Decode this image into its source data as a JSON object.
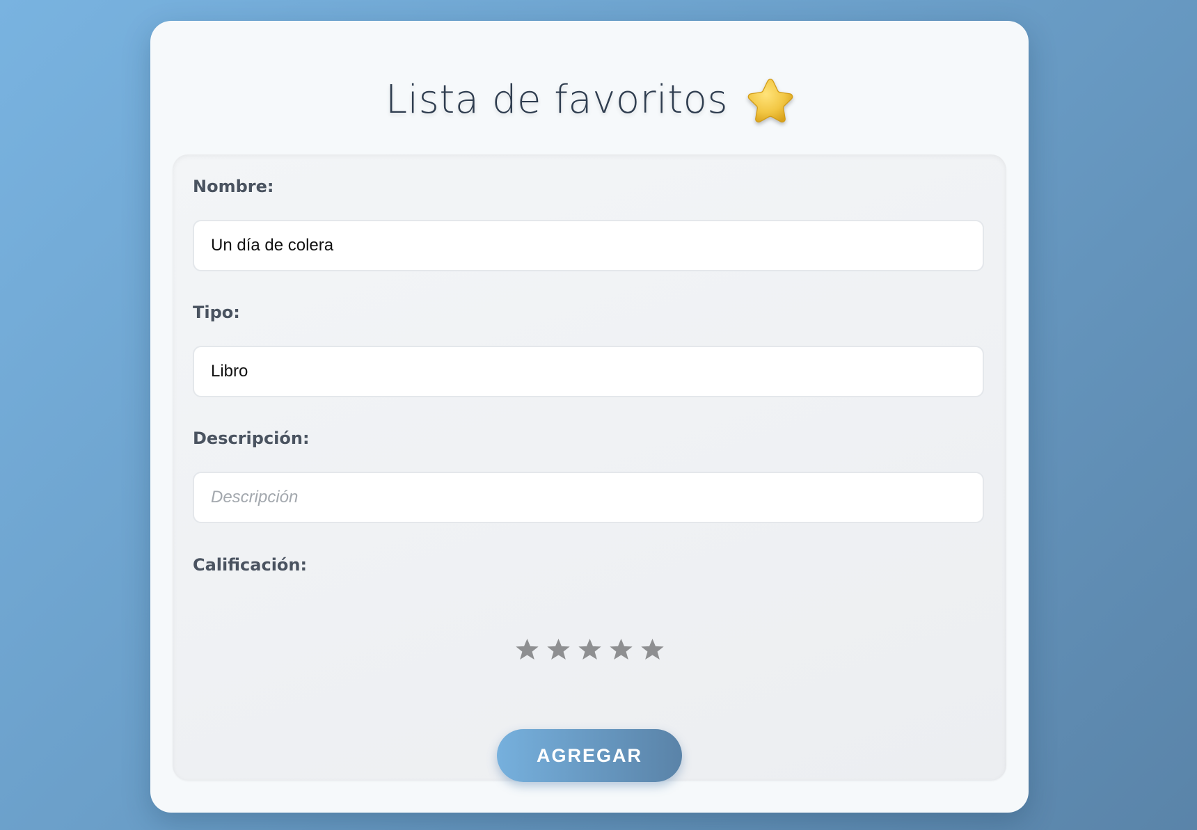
{
  "page": {
    "title": "Lista de favoritos",
    "title_icon": "star-icon"
  },
  "form": {
    "name": {
      "label": "Nombre:",
      "value": "Un día de colera"
    },
    "type": {
      "label": "Tipo:",
      "value": "Libro"
    },
    "description": {
      "label": "Descripción:",
      "value": "",
      "placeholder": "Descripción"
    },
    "rating": {
      "label": "Calificación:",
      "max": 5,
      "selected": 0,
      "star_color": "#8e8f91"
    },
    "submit_label": "AGREGAR"
  },
  "colors": {
    "accent_start": "#76b0dd",
    "accent_end": "#5a83a8",
    "title_star": "#f2c744"
  }
}
